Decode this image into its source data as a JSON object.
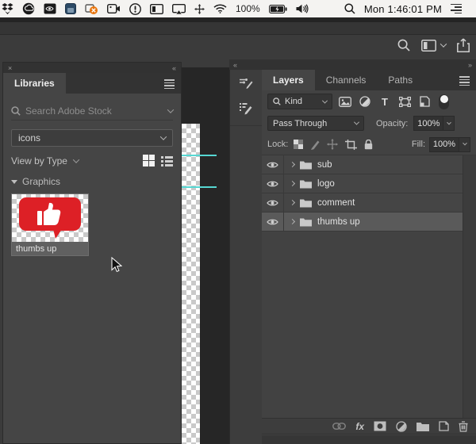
{
  "menu_bar": {
    "icons": [
      "dropbox-icon",
      "creative-cloud-icon",
      "nvidia-icon",
      "parallels-icon",
      "sync-error-icon",
      "camera-icon",
      "onepassword-icon",
      "display-icon",
      "airplay-icon",
      "move-icon",
      "wifi-icon",
      "battery-icon",
      "volume-icon",
      "spotlight-icon",
      "notification-center-icon"
    ],
    "battery_percent": "100%",
    "clock": "Mon 1:46:01 PM"
  },
  "app_header": {
    "icons": [
      "search-icon",
      "workspace-switcher-icon",
      "share-icon"
    ]
  },
  "libraries_panel": {
    "tab_label": "Libraries",
    "search_placeholder": "Search Adobe Stock",
    "library_select_value": "icons",
    "view_by_label": "View by Type",
    "section_label": "Graphics",
    "items": [
      {
        "label": "thumbs up",
        "type": "graphic"
      }
    ]
  },
  "canvas": {
    "guide_color": "#56d7d2",
    "guides_y": [
      195,
      235
    ]
  },
  "layers_panel": {
    "tabs": [
      "Layers",
      "Channels",
      "Paths"
    ],
    "active_tab": "Layers",
    "filter_kind_value": "Kind",
    "blend_mode_value": "Pass Through",
    "opacity_label": "Opacity:",
    "opacity_value": "100%",
    "lock_label": "Lock:",
    "fill_label": "Fill:",
    "fill_value": "100%",
    "layers": [
      {
        "name": "sub",
        "type": "group",
        "visible": true,
        "selected": false
      },
      {
        "name": "logo",
        "type": "group",
        "visible": true,
        "selected": false
      },
      {
        "name": "comment",
        "type": "group",
        "visible": true,
        "selected": false
      },
      {
        "name": "thumbs up",
        "type": "group",
        "visible": true,
        "selected": true
      }
    ],
    "bottom_icons": [
      "link-layers-icon",
      "layer-style-icon",
      "layer-mask-icon",
      "adjustment-layer-icon",
      "new-group-icon",
      "new-layer-icon",
      "delete-layer-icon"
    ]
  },
  "colors": {
    "accent_red": "#dd2026",
    "guide_cyan": "#56d7d2",
    "menu_bar_bg": "#f4f3f1",
    "panel_bg": "#454545",
    "selected_row_bg": "#5a5a5a"
  }
}
